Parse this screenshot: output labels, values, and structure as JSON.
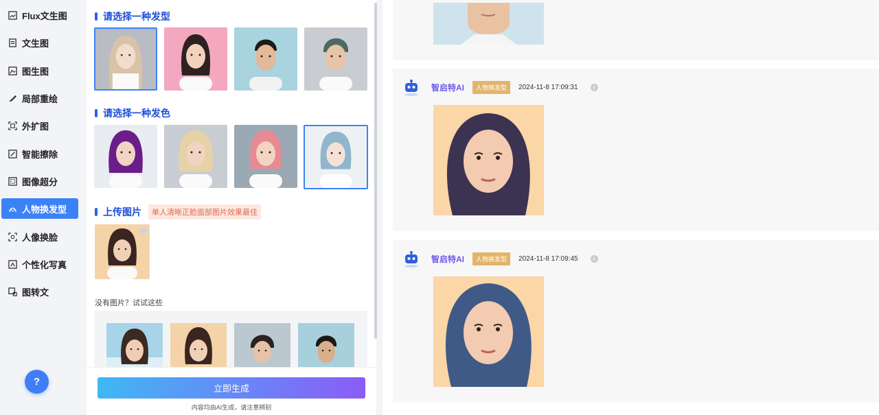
{
  "sidebar": {
    "items": [
      {
        "label": "Flux文生图",
        "icon": "image-icon"
      },
      {
        "label": "文生图",
        "icon": "document-icon"
      },
      {
        "label": "图生图",
        "icon": "picture-icon"
      },
      {
        "label": "局部重绘",
        "icon": "brush-icon"
      },
      {
        "label": "外扩图",
        "icon": "expand-icon"
      },
      {
        "label": "智能擦除",
        "icon": "eraser-icon"
      },
      {
        "label": "图像超分",
        "icon": "upscale-icon"
      },
      {
        "label": "人物换发型",
        "icon": "hairstyle-icon"
      },
      {
        "label": "人像换脸",
        "icon": "face-swap-icon"
      },
      {
        "label": "个性化写真",
        "icon": "portrait-icon"
      },
      {
        "label": "图转文",
        "icon": "image-to-text-icon"
      }
    ],
    "active_index": 7,
    "help_label": "?"
  },
  "panel": {
    "hairstyle_title": "请选择一种发型",
    "haircolor_title": "请选择一种发色",
    "upload_title": "上传图片",
    "upload_tip": "单人清晰正脸面部图片效果最佳",
    "sample_hint": "没有图片？试试这些",
    "generate_label": "立即生成",
    "disclaimer": "内容均由AI生成，请注意辨别"
  },
  "results": [
    {
      "bot_name": "智启特AI",
      "tag": "人物换发型",
      "time": "2024-11-8 17:09:31"
    },
    {
      "bot_name": "智启特AI",
      "tag": "人物换发型",
      "time": "2024-11-8 17:09:45"
    }
  ],
  "colors": {
    "accent": "#3b82f6",
    "title_blue": "#1d4ed8",
    "tag_bg": "#e3b46a",
    "bot_name": "#6d5ce8",
    "gradient_start": "#3fb8f5",
    "gradient_end": "#8b5cf6"
  }
}
